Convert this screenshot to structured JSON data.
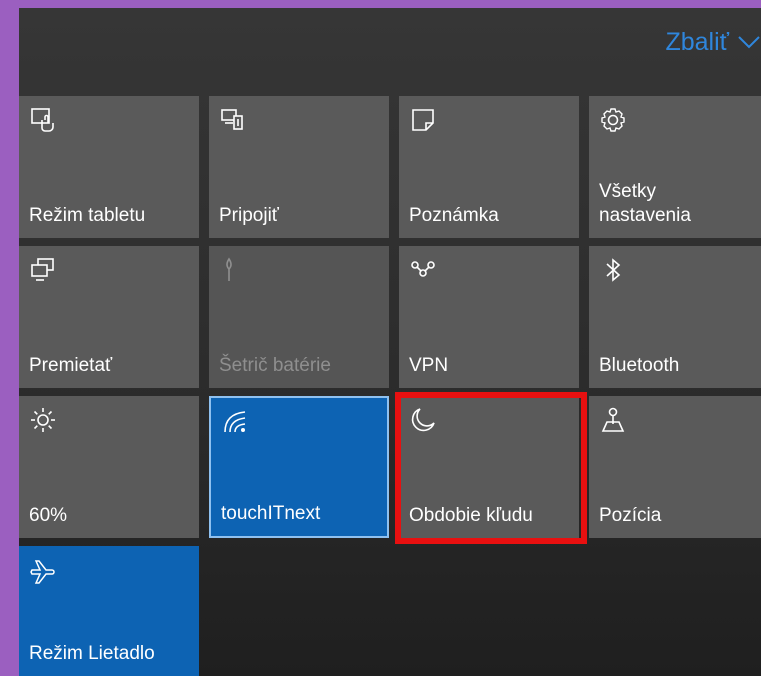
{
  "header": {
    "collapse_label": "Zbaliť",
    "collapse_icon": "chevron-down-icon",
    "accent_color": "#2f86dc"
  },
  "tiles": [
    {
      "label": "Režim tabletu",
      "icon": "tablet-mode-icon",
      "state": "off"
    },
    {
      "label": "Pripojiť",
      "icon": "connect-icon",
      "state": "off"
    },
    {
      "label": "Poznámka",
      "icon": "note-icon",
      "state": "off"
    },
    {
      "label": "Všetky nastavenia",
      "icon": "gear-icon",
      "state": "off"
    },
    {
      "label": "Premietať",
      "icon": "project-icon",
      "state": "off"
    },
    {
      "label": "Šetrič batérie",
      "icon": "battery-saver-icon",
      "state": "disabled"
    },
    {
      "label": "VPN",
      "icon": "vpn-icon",
      "state": "off"
    },
    {
      "label": "Bluetooth",
      "icon": "bluetooth-icon",
      "state": "off"
    },
    {
      "label": "60%",
      "icon": "brightness-icon",
      "state": "off"
    },
    {
      "label": "touchITnext",
      "icon": "wifi-icon",
      "state": "on"
    },
    {
      "label": "Obdobie kľudu",
      "icon": "moon-icon",
      "state": "off",
      "highlighted": true
    },
    {
      "label": "Pozícia",
      "icon": "location-icon",
      "state": "off"
    },
    {
      "label": "Režim Lietadlo",
      "icon": "airplane-icon",
      "state": "on"
    }
  ],
  "colors": {
    "tile_off": "#5a5a5a",
    "tile_on": "#0d63b3",
    "tile_disabled_text": "#8f8f8f",
    "highlight": "#e81010",
    "background": "#9b5fc0"
  }
}
